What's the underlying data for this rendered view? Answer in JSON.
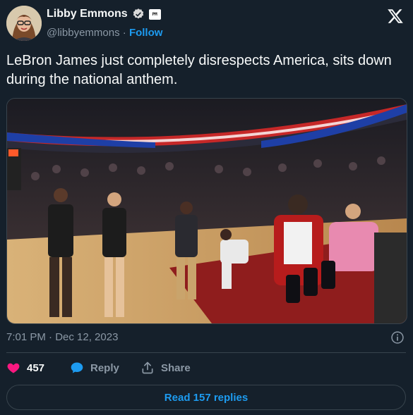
{
  "author": {
    "name": "Libby Emmons",
    "handle": "@libbyemmons",
    "separator": "·",
    "follow_label": "Follow",
    "affiliate_badge": "PM"
  },
  "tweet": {
    "text": "LeBron James just completely disrespects America, sits down during the national anthem.",
    "timestamp": "7:01 PM · Dec 12, 2023"
  },
  "actions": {
    "like_count": "457",
    "reply_label": "Reply",
    "share_label": "Share"
  },
  "read_replies_label": "Read 157 replies",
  "icons": {
    "verified": "verified-badge-icon",
    "logo": "x-logo-icon",
    "info": "info-icon",
    "like": "heart-icon",
    "reply": "reply-bubble-icon",
    "share": "share-icon"
  },
  "colors": {
    "background": "#15202b",
    "accent": "#1d9bf0",
    "like": "#f91880",
    "muted": "#8b98a5"
  }
}
